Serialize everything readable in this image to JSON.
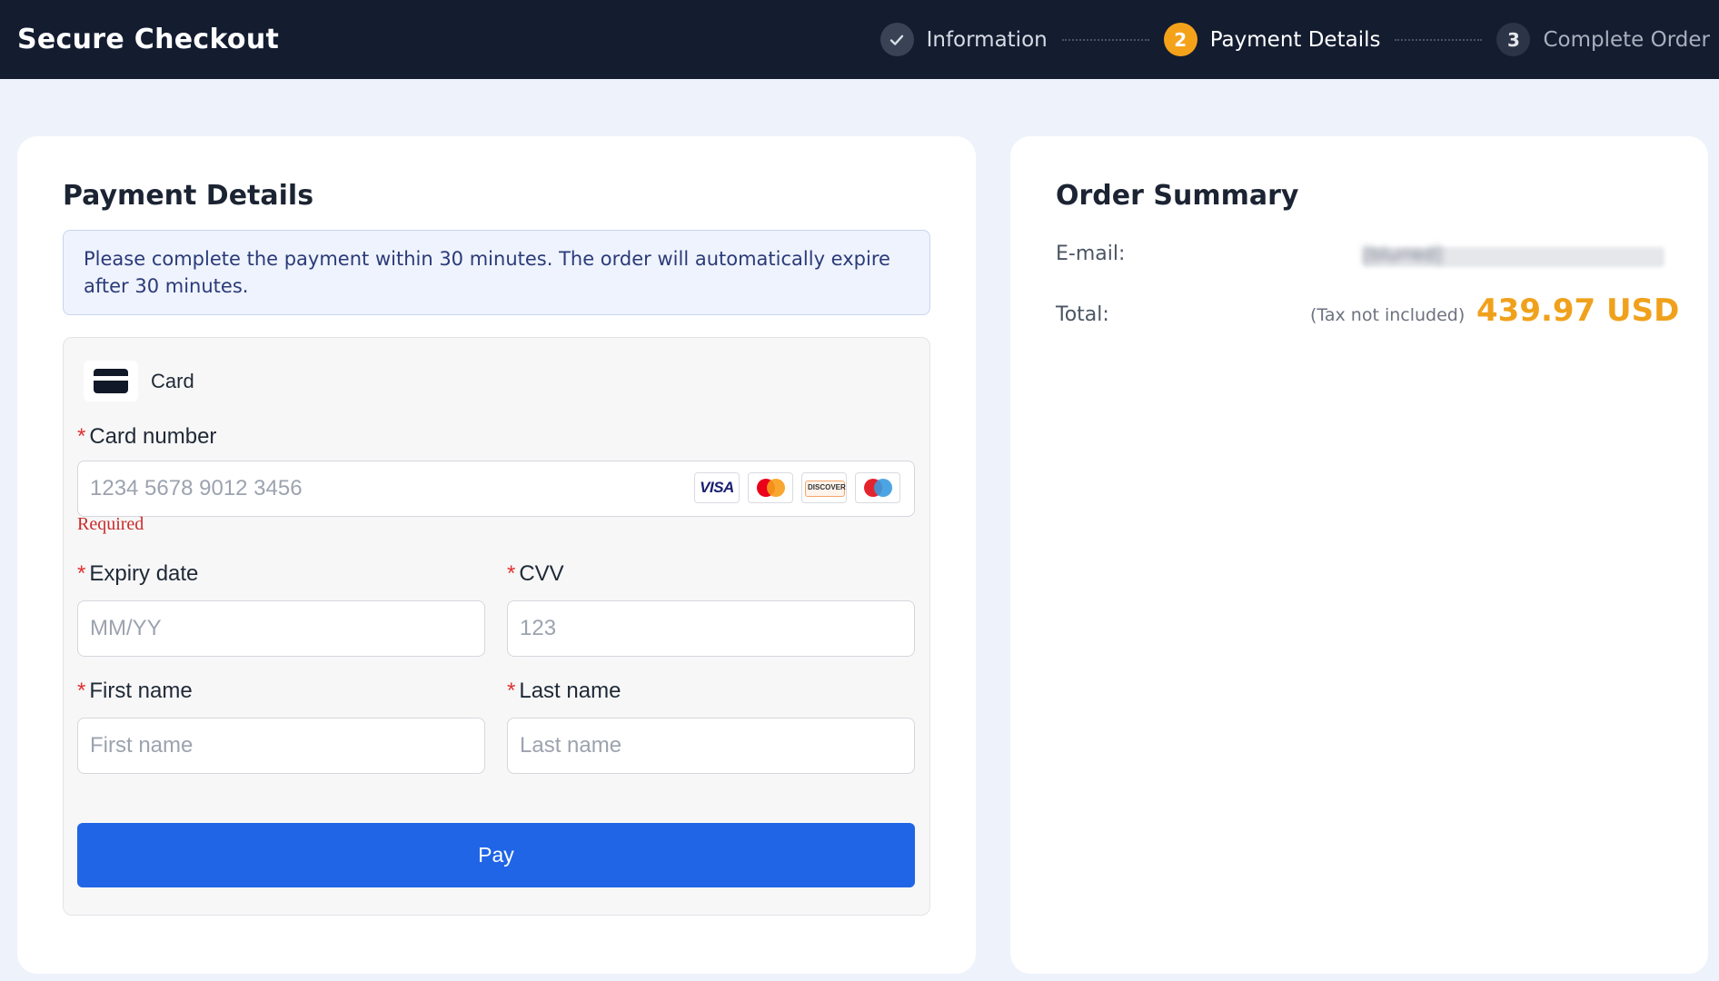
{
  "header": {
    "title": "Secure Checkout",
    "steps": [
      {
        "number": "✓",
        "label": "Information",
        "state": "done"
      },
      {
        "number": "2",
        "label": "Payment Details",
        "state": "active"
      },
      {
        "number": "3",
        "label": "Complete Order",
        "state": "todo"
      }
    ]
  },
  "payment": {
    "title": "Payment Details",
    "notice": "Please complete the payment within 30 minutes. The order will automatically expire after 30 minutes.",
    "method": {
      "icon": "credit-card-icon",
      "label": "Card"
    },
    "card_number": {
      "label": "Card number",
      "placeholder": "1234 5678 9012 3456",
      "value": "",
      "error": "Required"
    },
    "card_brands": [
      "VISA",
      "Mastercard",
      "DISCOVER",
      "Maestro"
    ],
    "expiry": {
      "label": "Expiry date",
      "placeholder": "MM/YY",
      "value": ""
    },
    "cvv": {
      "label": "CVV",
      "placeholder": "123",
      "value": ""
    },
    "first_name": {
      "label": "First name",
      "placeholder": "First name",
      "value": ""
    },
    "last_name": {
      "label": "Last name",
      "placeholder": "Last name",
      "value": ""
    },
    "required_marker": "*",
    "pay_label": "Pay"
  },
  "summary": {
    "title": "Order Summary",
    "email_label": "E-mail:",
    "email_value": "[blurred]",
    "total_label": "Total:",
    "tax_note": "(Tax not included)",
    "total_amount": "439.97 USD"
  },
  "colors": {
    "header_bg": "#141c30",
    "accent_orange": "#f5a21b",
    "pay_button": "#1f65e6",
    "error_red": "#c92a2a",
    "total_color": "#f0a11c"
  }
}
